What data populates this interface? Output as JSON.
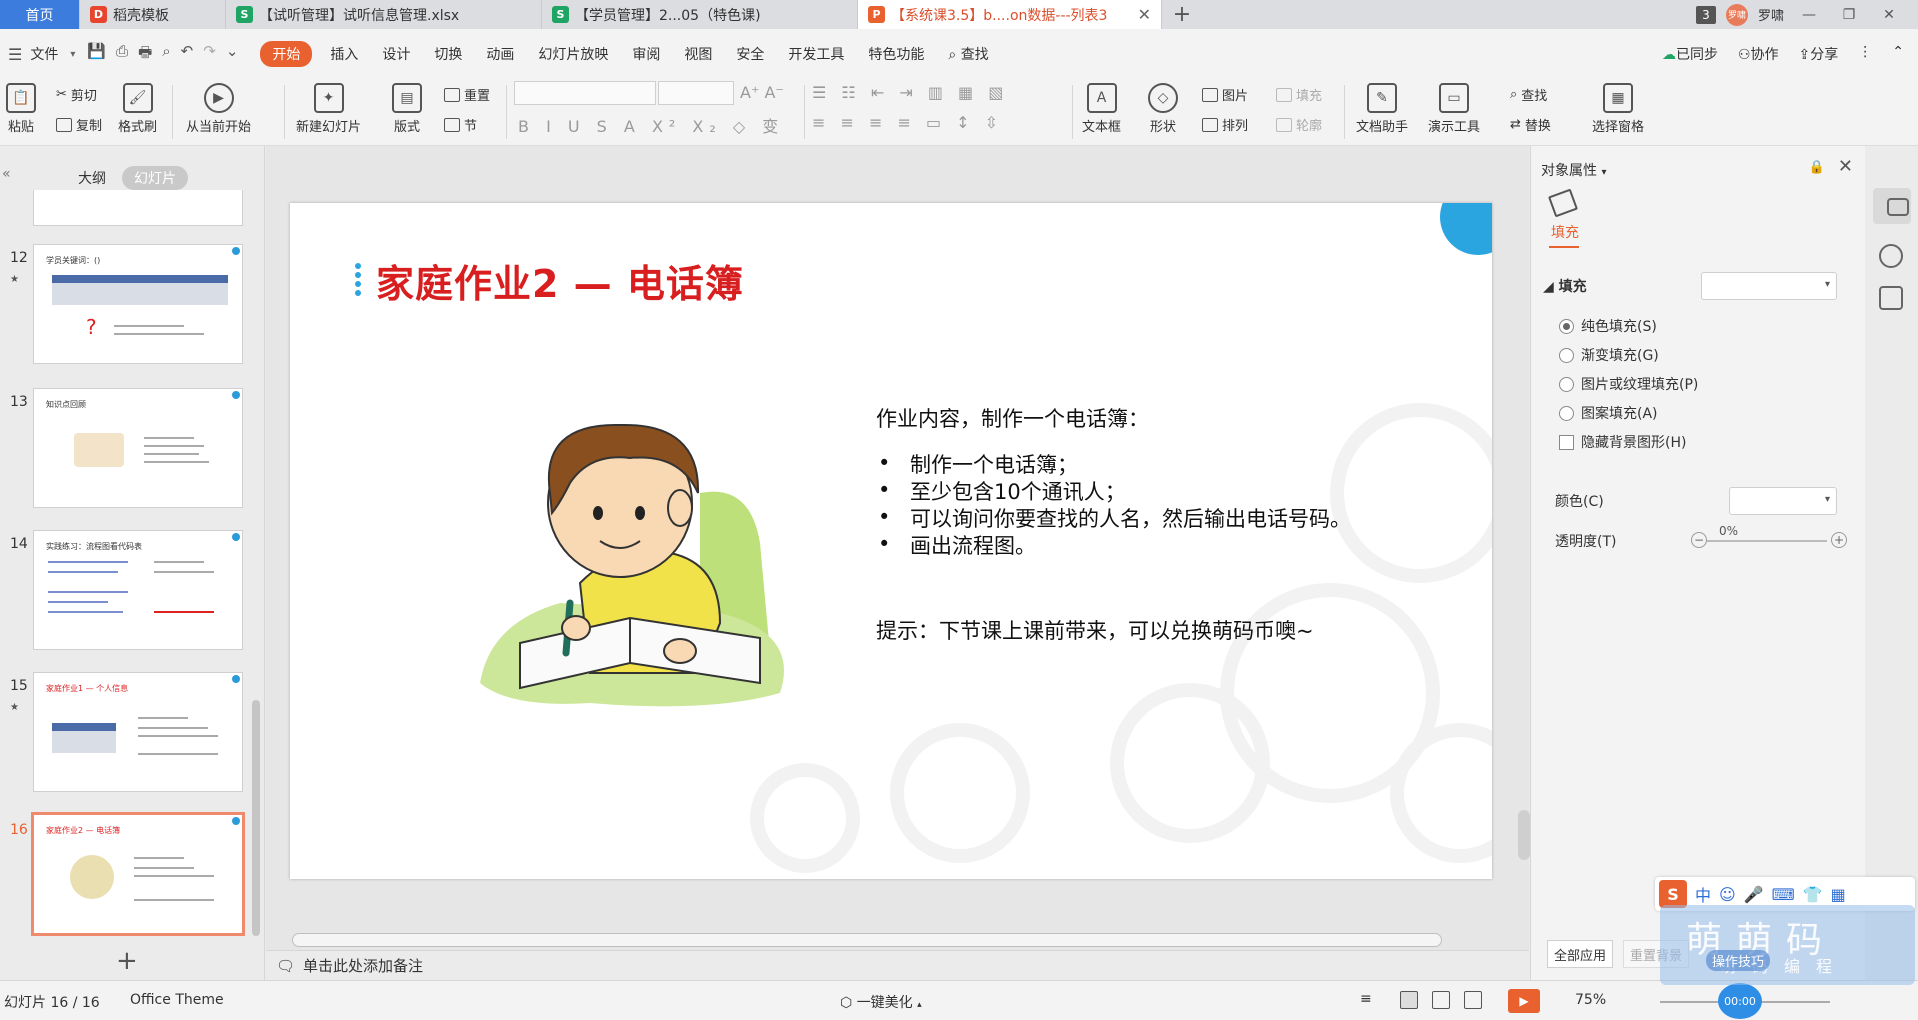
{
  "tabs": {
    "home": "首页",
    "t1": "稻壳模板",
    "t2": "【试听管理】试听信息管理.xlsx",
    "t3": "【学员管理】2...05（特色课)",
    "t4": "【系统课3.5】b....on数据---列表3",
    "count": "3",
    "user": "罗啸",
    "avatar": "罗啸"
  },
  "menu": {
    "file": "文件",
    "items": [
      "开始",
      "插入",
      "设计",
      "切换",
      "动画",
      "幻灯片放映",
      "审阅",
      "视图",
      "安全",
      "开发工具",
      "特色功能"
    ],
    "search": "查找",
    "synced": "已同步",
    "collab": "协作",
    "share": "分享"
  },
  "ribbon": {
    "paste": "粘贴",
    "cut": "剪切",
    "copy": "复制",
    "format_painter": "格式刷",
    "from_current": "从当前开始",
    "new_slide": "新建幻灯片",
    "layout": "版式",
    "reset": "重置",
    "section": "节",
    "textbox": "文本框",
    "shape": "形状",
    "picture": "图片",
    "arrange": "排列",
    "fill": "填充",
    "outline": "轮廓",
    "doc_assistant": "文档助手",
    "present_tools": "演示工具",
    "find": "查找",
    "replace": "替换",
    "select_pane": "选择窗格"
  },
  "left": {
    "tab_outline": "大纲",
    "tab_slides": "幻灯片",
    "slides": [
      {
        "num": "12",
        "title": "学员关键词：()"
      },
      {
        "num": "13",
        "title": "知识点回顾"
      },
      {
        "num": "14",
        "title": "实践练习：流程图看代码表"
      },
      {
        "num": "15",
        "title": "家庭作业1 — 个人信息"
      },
      {
        "num": "16",
        "title": "家庭作业2 — 电话簿"
      }
    ]
  },
  "slide": {
    "title": "家庭作业2 — 电话簿",
    "intro": "作业内容，制作一个电话簿：",
    "bullets": [
      "制作一个电话簿；",
      "至少包含10个通讯人；",
      "可以询问你要查找的人名，然后输出电话号码。",
      "画出流程图。"
    ],
    "hint": "提示：下节课上课前带来，可以兑换萌码币噢~",
    "bullet_char": "•"
  },
  "notes": "单击此处添加备注",
  "panel": {
    "title": "对象属性",
    "tab": "填充",
    "section": "填充",
    "options": [
      "纯色填充(S)",
      "渐变填充(G)",
      "图片或纹理填充(P)",
      "图案填充(A)"
    ],
    "hide_bg": "隐藏背景图形(H)",
    "color": "颜色(C)",
    "transparency": "透明度(T)",
    "transparency_value": "0%",
    "apply_all": "全部应用",
    "reset_bg": "重置背景"
  },
  "status": {
    "slide_pos": "幻灯片 16 / 16",
    "theme": "Office Theme",
    "beautify": "一键美化",
    "zoom": "75%",
    "time": "00:00"
  },
  "overlay": {
    "ime_lang": "中",
    "wm1": "萌萌码",
    "wm2": "萌码编程",
    "tips": "操作技巧"
  },
  "colors": {
    "accent": "#e8612f",
    "title_red": "#d81e1e",
    "brand_blue": "#2aa5e0"
  }
}
